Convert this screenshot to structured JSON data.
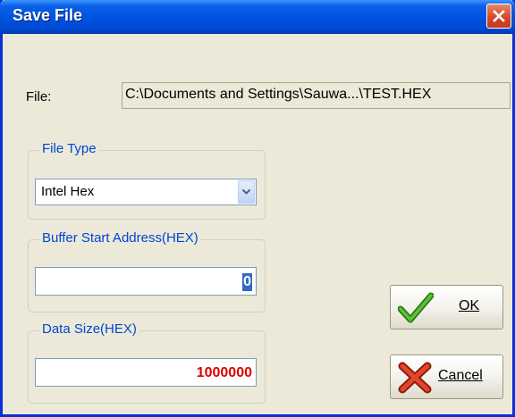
{
  "window": {
    "title": "Save File"
  },
  "file": {
    "label": "File:",
    "path": "C:\\Documents and Settings\\Sauwa...\\TEST.HEX"
  },
  "file_type": {
    "legend": "File Type",
    "selected": "Intel Hex"
  },
  "buffer_start": {
    "legend": "Buffer Start Address(HEX)",
    "value": "0"
  },
  "data_size": {
    "legend": "Data Size(HEX)",
    "value": "1000000"
  },
  "buttons": {
    "ok_label": "OK",
    "cancel_label": "Cancel"
  },
  "icons": {
    "close": "close-icon",
    "dropdown": "chevron-down-icon",
    "ok": "checkmark-icon",
    "cancel": "x-icon"
  },
  "colors": {
    "titlebar": "#0054e3",
    "dialog_bg": "#ece9d8",
    "legend_text": "#0046d5",
    "selection_bg": "#316ac5",
    "data_size_text": "#e00000",
    "check_green": "#3a9a1a",
    "cross_red": "#d23a1a"
  }
}
